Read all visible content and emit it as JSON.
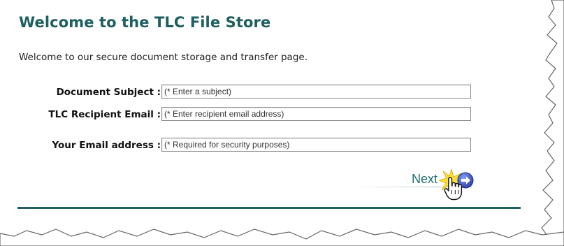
{
  "header": {
    "title": "Welcome to the TLC File Store",
    "intro": "Welcome to our secure document storage and transfer page."
  },
  "form": {
    "fields": [
      {
        "label": "Document Subject :",
        "value": "(* Enter a subject)"
      },
      {
        "label": "TLC Recipient Email :",
        "value": "(* Enter recipient email address)"
      },
      {
        "label": "Your Email address :",
        "value": "(* Required for security purposes)"
      }
    ],
    "next_label": "Next"
  },
  "colors": {
    "accent": "#1f5f5f",
    "next_button": "#3a4fb0"
  }
}
